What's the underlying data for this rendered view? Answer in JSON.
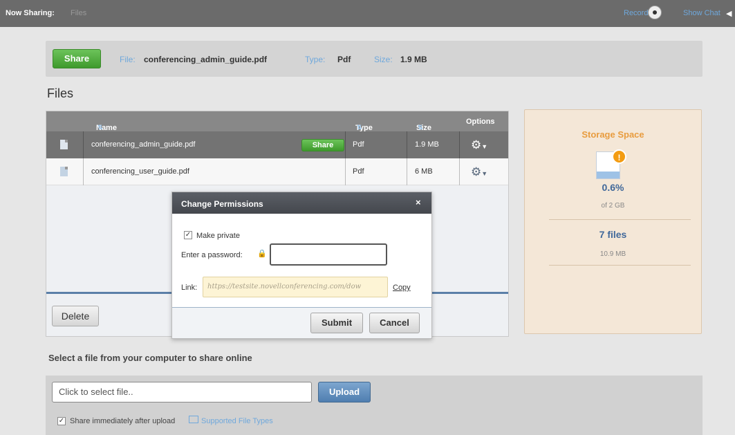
{
  "topbar": {
    "now_sharing_label": "Now Sharing:",
    "now_sharing_value": "Files",
    "record_label": "Record",
    "show_chat_label": "Show Chat"
  },
  "banner": {
    "share_label": "Share",
    "file_label": "File:",
    "file_value": "conferencing_admin_guide.pdf",
    "type_label": "Type:",
    "type_value": "Pdf",
    "size_label": "Size:",
    "size_value": "1.9 MB"
  },
  "files": {
    "title": "Files",
    "columns": {
      "name": "Name",
      "type": "Type",
      "size": "Size",
      "options": "Options"
    },
    "rows": [
      {
        "name": "conferencing_admin_guide.pdf",
        "share_label": "Share",
        "type": "Pdf",
        "size": "1.9 MB",
        "selected": true
      },
      {
        "name": "conferencing_user_guide.pdf",
        "type": "Pdf",
        "size": "6 MB",
        "selected": false
      }
    ],
    "delete_label": "Delete"
  },
  "storage": {
    "title": "Storage Space",
    "usage_percent": "0.6%",
    "of_total": "of 2 GB",
    "file_count": "7 files",
    "files_size": "10.9 MB"
  },
  "modal": {
    "title": "Change Permissions",
    "close_glyph": "×",
    "make_private_label": "Make private",
    "make_private_checked": true,
    "password_label": "Enter a password:",
    "password_value": "",
    "link_label": "Link:",
    "link_value": "https://testsite.novellconferencing.com/dow",
    "copy_label": "Copy",
    "submit_label": "Submit",
    "cancel_label": "Cancel"
  },
  "upload": {
    "title": "Select a file from your computer to share online",
    "file_placeholder": "Click to select file..",
    "upload_label": "Upload",
    "share_immediately_label": "Share immediately after upload",
    "share_immediately_checked": true,
    "supported_types_label": "Supported File Types"
  },
  "colors": {
    "accent_blue": "#6fa8dc",
    "share_green": "#4caf35",
    "storage_orange": "#e89c3f",
    "header_gray": "#6b6b6b"
  }
}
